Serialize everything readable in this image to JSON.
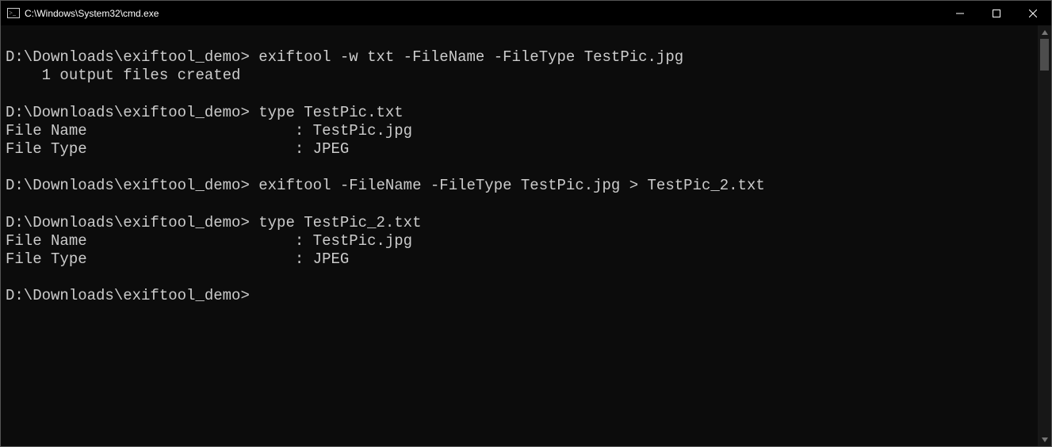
{
  "window": {
    "title": "C:\\Windows\\System32\\cmd.exe"
  },
  "terminal": {
    "prompt": "D:\\Downloads\\exiftool_demo>",
    "blocks": [
      {
        "command": "exiftool -w txt -FileName -FileType TestPic.jpg",
        "output": "    1 output files created"
      },
      {
        "command": "type TestPic.txt",
        "output": "File Name                       : TestPic.jpg\nFile Type                       : JPEG"
      },
      {
        "command": "exiftool -FileName -FileType TestPic.jpg > TestPic_2.txt",
        "output": ""
      },
      {
        "command": "type TestPic_2.txt",
        "output": "File Name                       : TestPic.jpg\nFile Type                       : JPEG"
      }
    ],
    "trailing_prompt": "D:\\Downloads\\exiftool_demo>"
  }
}
